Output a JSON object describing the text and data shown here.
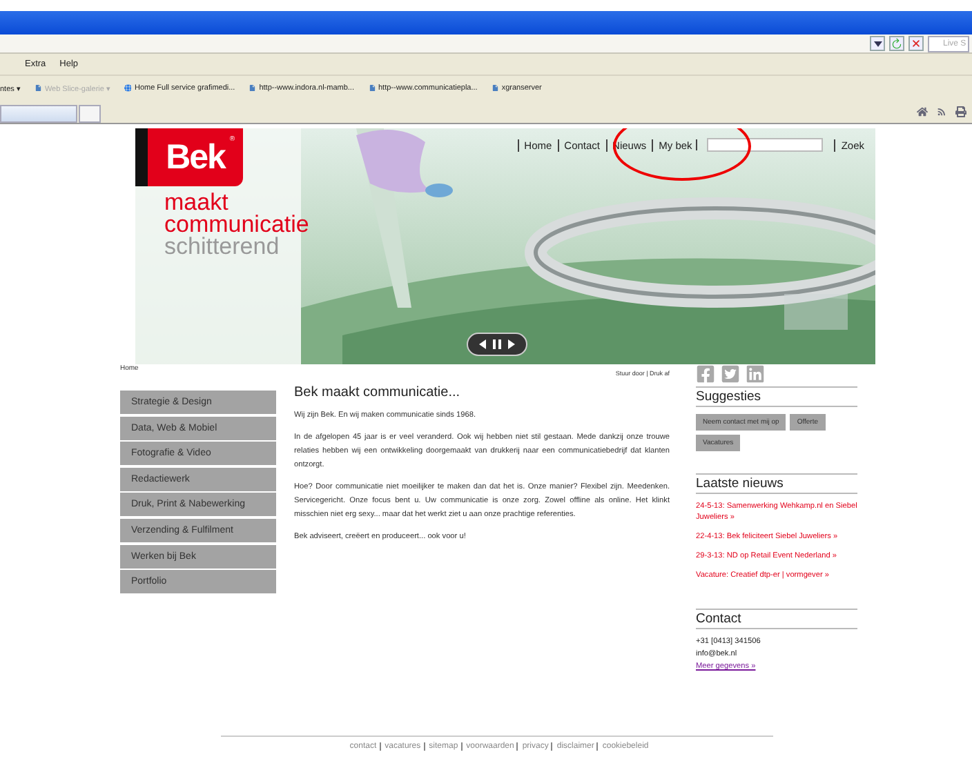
{
  "browser": {
    "address_right": "Live S",
    "menu": [
      "Extra",
      "Help"
    ],
    "favorites": [
      {
        "label": "ntes ▾",
        "kind": "cut",
        "disabled": false
      },
      {
        "label": "Web Slice-galerie ▾",
        "kind": "page",
        "disabled": true
      },
      {
        "label": "Home  Full service grafimedi...",
        "kind": "globe",
        "disabled": false
      },
      {
        "label": "http--www.indora.nl-mamb...",
        "kind": "page",
        "disabled": false
      },
      {
        "label": "http--www.communicatiepla...",
        "kind": "page",
        "disabled": false
      },
      {
        "label": "xgranserver",
        "kind": "page",
        "disabled": false
      }
    ]
  },
  "header": {
    "logo": "Bek",
    "logo_mark": "®",
    "tagline": [
      "maakt",
      "communicatie",
      "schitterend"
    ],
    "nav": [
      "Home",
      "Contact",
      "Nieuws",
      "My bek"
    ],
    "search_button": "Zoek"
  },
  "breadcrumb": "Home",
  "page_tools": "Stuur door | Druk af",
  "sidebar": {
    "items": [
      {
        "label": "Strategie & Design"
      },
      {
        "label": "Data, Web & Mobiel"
      },
      {
        "label": "Fotografie & Video"
      },
      {
        "label": "Redactiewerk"
      },
      {
        "label": "Druk, Print & Nabewerking"
      },
      {
        "label": "Verzending & Fulfilment"
      },
      {
        "label": "Werken bij Bek"
      },
      {
        "label": "Portfolio"
      }
    ]
  },
  "article": {
    "title": "Bek maakt communicatie...",
    "paragraphs": [
      "Wij zijn Bek. En wij maken communicatie sinds 1968.",
      "In de afgelopen 45 jaar is er veel veranderd. Ook wij hebben niet stil gestaan. Mede dankzij onze trouwe relaties hebben wij een ontwikkeling doorgemaakt van drukkerij naar een communicatiebedrijf dat klanten ontzorgt.",
      "Hoe? Door communicatie niet moeilijker te maken dan dat het is. Onze manier? Flexibel zijn. Meedenken. Servicegericht. Onze focus bent u. Uw communicatie is onze zorg. Zowel offline als online. Het klinkt misschien niet erg sexy... maar dat het werkt ziet u aan onze prachtige referenties.",
      "Bek adviseert, creëert en produceert... ook voor u!"
    ]
  },
  "social": [
    {
      "kind": "facebook"
    },
    {
      "kind": "twitter"
    },
    {
      "kind": "linkedin"
    }
  ],
  "suggestions": {
    "title": "Suggesties",
    "buttons": [
      "Neem contact met mij op",
      "Offerte",
      "Vacatures"
    ]
  },
  "news": {
    "title": "Laatste nieuws",
    "items": [
      "24-5-13: Samenwerking Wehkamp.nl en Siebel Juweliers »",
      "22-4-13: Bek feliciteert Siebel Juweliers »",
      "29-3-13: ND op Retail Event Nederland »",
      "Vacature: Creatief dtp-er | vormgever »"
    ]
  },
  "contact": {
    "title": "Contact",
    "lines": [
      "+31 [0413] 341506",
      "info@bek.nl"
    ],
    "link": "Meer gegevens »"
  },
  "footer": [
    "contact",
    "vacatures",
    "sitemap",
    "voorwaarden",
    "privacy",
    "disclaimer",
    "cookiebeleid"
  ]
}
